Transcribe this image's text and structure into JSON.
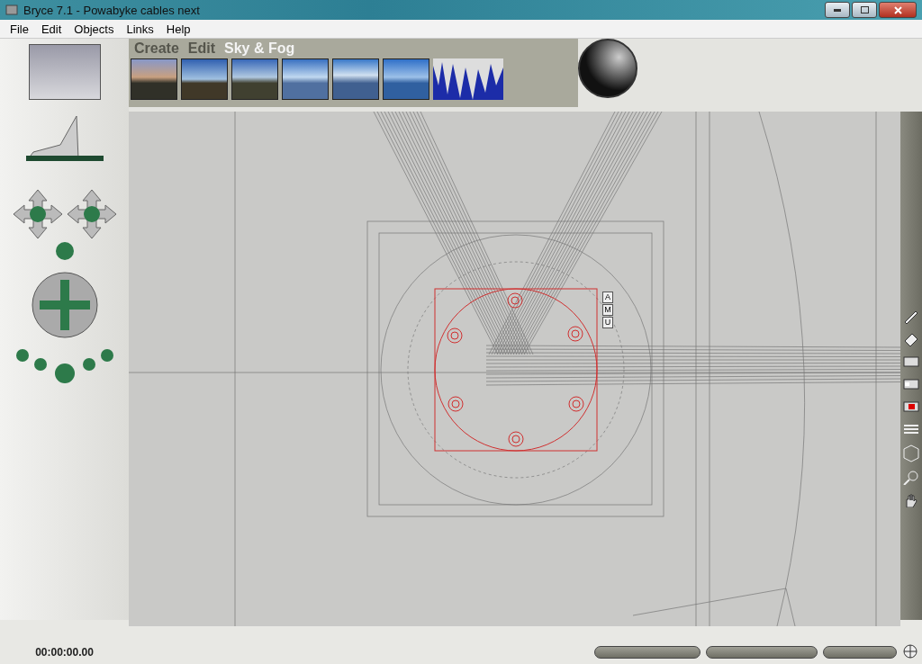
{
  "window": {
    "title": "Bryce 7.1  - Powabyke cables next"
  },
  "menu": [
    "File",
    "Edit",
    "Objects",
    "Links",
    "Help"
  ],
  "palette_tabs": [
    {
      "label": "Create",
      "selected": false
    },
    {
      "label": "Edit",
      "selected": false
    },
    {
      "label": "Sky & Fog",
      "selected": true
    }
  ],
  "selection_handles": [
    "A",
    "M",
    "U"
  ],
  "timecode": "00:00:00.00"
}
